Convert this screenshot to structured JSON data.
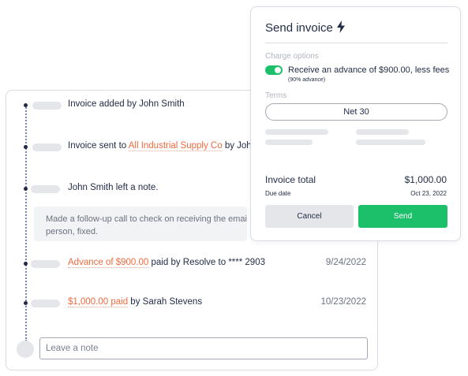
{
  "activity": {
    "entries": [
      {
        "prefix": "Invoice added by John Smith",
        "link": "",
        "suffix": "",
        "date": ""
      },
      {
        "prefix": "Invoice sent to ",
        "link": "All Industrial Supply Co",
        "suffix": " by John",
        "date": ""
      },
      {
        "prefix": "John Smith left a note.",
        "link": "",
        "suffix": "",
        "date": ""
      },
      {
        "prefix": "",
        "link": "Advance of $900.00",
        "suffix": " paid by Resolve to **** 2903",
        "date": "9/24/2022"
      },
      {
        "prefix": "",
        "link": "$1,000.00 paid",
        "suffix": " by Sarah Stevens",
        "date": "10/23/2022"
      }
    ],
    "note": {
      "line1": "Made a follow-up call to check on receiving the email",
      "line2": "person, fixed."
    },
    "note_input_placeholder": "Leave a note"
  },
  "invoice_panel": {
    "title": "Send invoice",
    "title_icon": "lightning-bolt-icon",
    "charge_options_label": "Charge options",
    "advance_toggle_on": true,
    "advance_label": "Receive an advance of $900.00, less fees",
    "advance_sublabel": "(90% advance)",
    "terms_label": "Terms",
    "terms_value": "Net 30",
    "total_label": "Invoice total",
    "total_value": "$1,000.00",
    "due_label": "Due date",
    "due_value": "Oct 23, 2022",
    "cancel_label": "Cancel",
    "send_label": "Send"
  },
  "colors": {
    "accent_green": "#1cbf6a",
    "link_orange": "#f06a3f",
    "text_dark": "#1f2a44"
  }
}
